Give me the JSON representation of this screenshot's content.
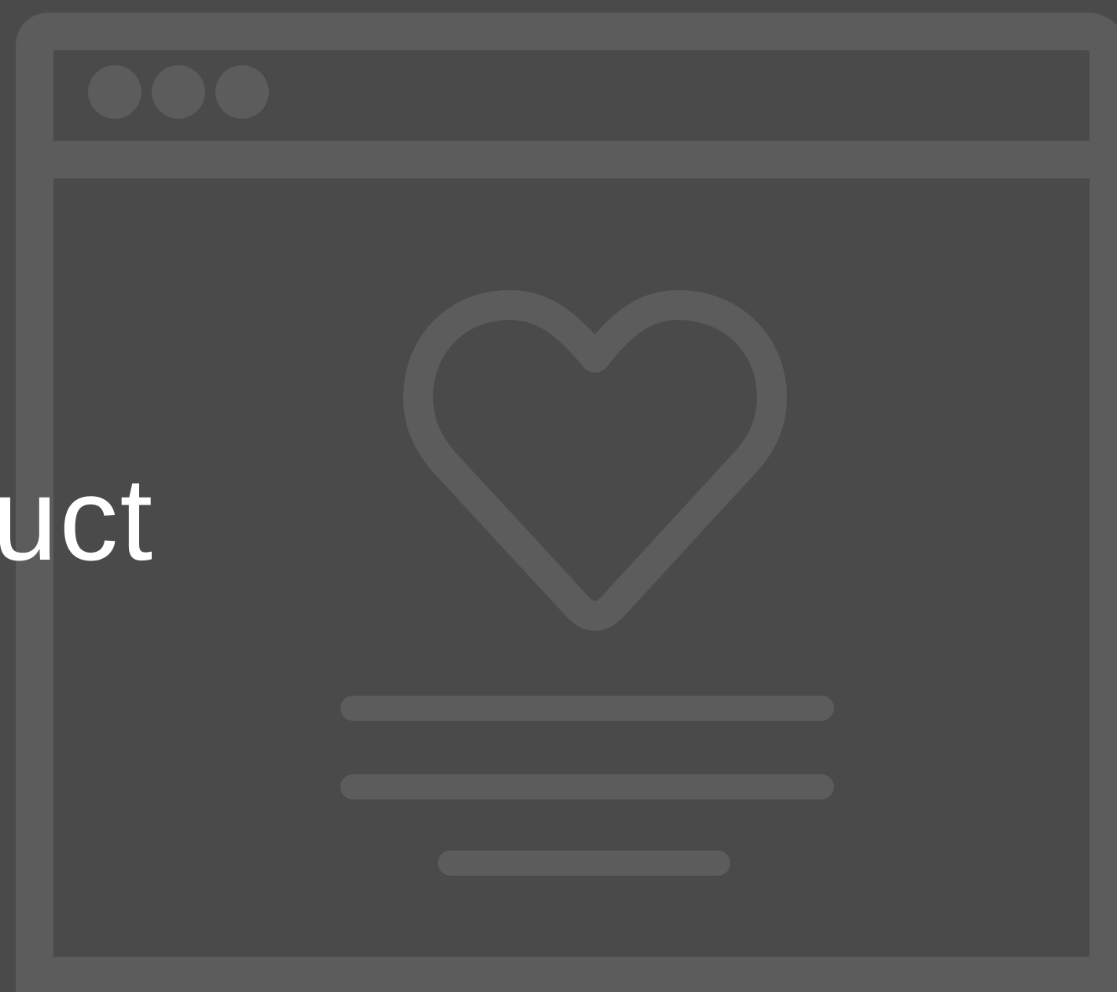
{
  "caption": {
    "text": "uct"
  },
  "illustration": {
    "icon": "browser-window-heart-icon",
    "window_dots": [
      "dot",
      "dot",
      "dot"
    ],
    "text_lines": [
      "line",
      "line",
      "line"
    ]
  },
  "colors": {
    "background": "#4a4a4a",
    "stroke": "#5c5c5c",
    "caption_text": "#ffffff"
  }
}
